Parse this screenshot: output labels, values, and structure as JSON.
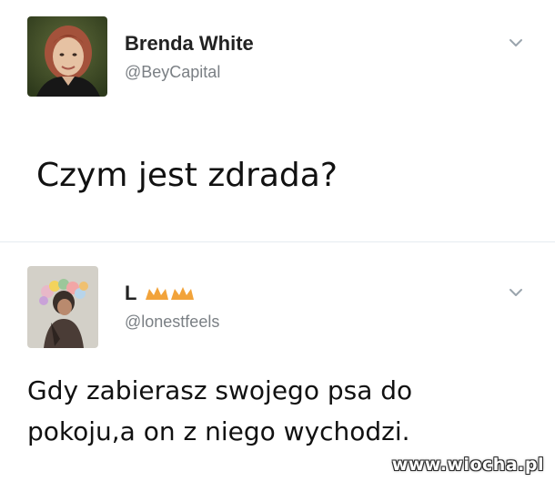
{
  "tweets": [
    {
      "author": {
        "name": "Brenda White",
        "handle": "@BeyCapital",
        "name_emoji": ""
      },
      "text": "Czym jest zdrada?",
      "menu_icon": "chevron-down-icon"
    },
    {
      "author": {
        "name": "L",
        "handle": "@lonestfeels",
        "name_emoji": "crown-emojis"
      },
      "text": "Gdy zabierasz swojego psa do pokoju,a on z niego wychodzi.",
      "menu_icon": "chevron-down-icon"
    }
  ],
  "watermark": "www.wiocha.pl",
  "colors": {
    "name": "#222222",
    "handle": "#7a7f84",
    "caret": "#9aa4ad",
    "crown": "#f2a33a"
  }
}
